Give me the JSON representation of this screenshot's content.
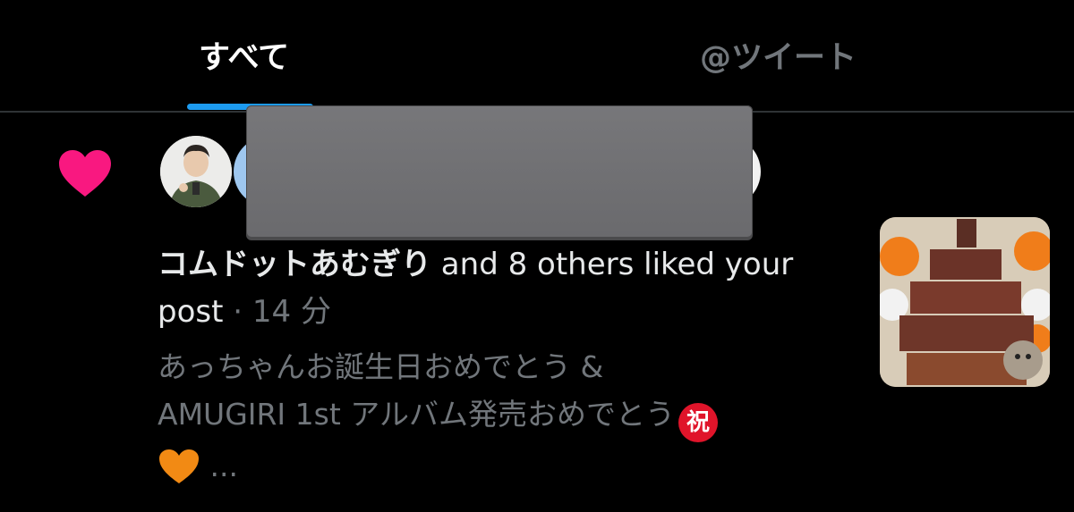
{
  "tabs": {
    "all_label": "すべて",
    "mentions_label": "@ツイート"
  },
  "notification": {
    "actor_name": "コムドットあむぎり",
    "action_text": " and 8 others liked your post",
    "separator": " · ",
    "timestamp": "14 分",
    "post_line1": "あっちゃんお誕生日おめでとう &",
    "post_line2": "AMUGIRI 1st アルバム発売おめでとう",
    "post_emoji_celebrate": "祝",
    "post_ellipsis": " ..."
  },
  "icons": {
    "like": "heart-icon",
    "celebrate": "celebrate-icon",
    "orange_heart": "orange-heart-icon"
  },
  "colors": {
    "background": "#000000",
    "accent": "#1d9bf0",
    "heart": "#f91880",
    "muted_text": "#71767b",
    "primary_text": "#e7e9ea"
  }
}
